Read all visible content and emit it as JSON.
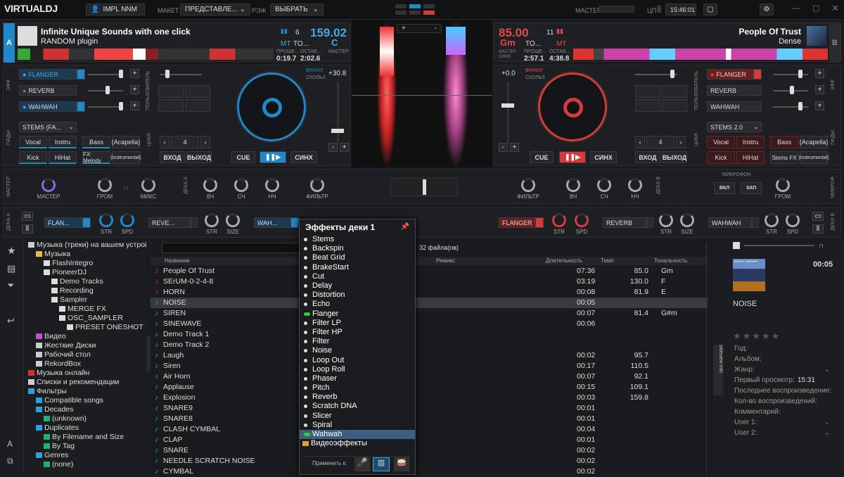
{
  "app": {
    "logo": "VIRTUALDJ",
    "user": "IMPL NNM",
    "layout_label": "МАКЕТ",
    "layout_value": "ПРЕДСТАВЛЕ...",
    "mode_label": "РЭЖ",
    "mode_value": "ВЫБРАТЬ",
    "master_label": "МАСТЕР",
    "cpu_label": "ЦП",
    "clock": "15:46:01"
  },
  "deck_a": {
    "side": "A",
    "title": "Infinite Unique Sounds with one click",
    "artist": "RANDOM plugin",
    "bpm": "159.02",
    "key": "C",
    "key_label": "TO...",
    "pitch_small": "6",
    "elapsed_label": "ПРОШЕ...",
    "elapsed": "0:19.7",
    "remain_label": "ОСТАВ...",
    "remain": "2:02.6",
    "master_label": "МАСТЕР",
    "master_val": "MT",
    "color": "#1e88c8"
  },
  "deck_b": {
    "side": "B",
    "title": "People Of Trust",
    "artist": "Dense",
    "bpm": "85.00",
    "key": "Gm",
    "key_label": "TO...",
    "pitch_small": "11",
    "elapsed_label": "ПРОШЕ...",
    "elapsed": "2:57.1",
    "remain_label": "ОСТАВ...",
    "remain": "4:38.8",
    "sync_label": "СИНХ",
    "master_label": "МАСТЕР",
    "master_val": "MT",
    "color": "#d73a3a"
  },
  "fx_a": {
    "label": "ЭФФ",
    "items": [
      "FLANGER",
      "REVERB",
      "WAHWAH"
    ]
  },
  "fx_b": {
    "label": "ЭФФ",
    "items": [
      "FLANGER",
      "REVERB",
      "WAHWAH"
    ]
  },
  "user_label": "ПОЛЬЗОВАТЕЛЬ",
  "pads_a": {
    "label": "ПАДЫ",
    "stems": "STEMS (FA...",
    "row1": [
      "Vocal",
      "Instru",
      "Bass",
      "(Acapella)"
    ],
    "row2": [
      "Kick",
      "HiHat",
      "FX: Melody",
      "(Instrumental)"
    ],
    "loop_label": "ЦИКЛ",
    "loop": "4",
    "in": "ВХОД",
    "out": "ВЫХОД"
  },
  "pads_b": {
    "label": "ПАДЫ",
    "stems": "STEMS 2.0",
    "row1": [
      "Vocal",
      "Instru",
      "Bass",
      "(Acapella)"
    ],
    "row2": [
      "Kick",
      "HiHat",
      "Stems FX",
      "(Instrumental)"
    ],
    "loop_label": "ЦИКЛ",
    "loop": "4",
    "in": "ВХОД",
    "out": "ВЫХОД"
  },
  "transport_a": {
    "cue": "CUE",
    "sync": "СИНХ",
    "pitch": "+30.8",
    "vinyl1": "ВИНИЛ",
    "vinyl2": "СКОЛЬЗ"
  },
  "transport_b": {
    "cue": "CUE",
    "sync": "СИНХ",
    "pitch": "+0.0",
    "vinyl1": "ВИНИЛ",
    "vinyl2": "СКОЛЬЗ"
  },
  "mixer": {
    "master_side": "МАСТЕР",
    "master": "МАСТЕР",
    "vol": "ГРОМ",
    "mix": "МИКС",
    "hi": "ВЧ",
    "mid": "СЧ",
    "low": "НЧ",
    "filter": "ФИЛЬТР",
    "deck_a": "ДЕКА А",
    "deck_b": "ДЕКА В",
    "mic": "МИКРОФОН",
    "mic_on": "ВКЛ",
    "rec": "ЗАП",
    "mic_vol": "ГРОМ",
    "mic_side": "МИКРОФ"
  },
  "deckfx_a": {
    "side": "ДЕКА А",
    "fx1": "FLAN...",
    "fx2": "REVE...",
    "fx3": "WAH...",
    "str": "STR",
    "spd": "SPD",
    "size": "SIZE"
  },
  "deckfx_b": {
    "side": "ДЕКА В",
    "fx1": "FLANGER",
    "fx2": "REVERB",
    "fx3": "WAHWAH",
    "str": "STR",
    "spd": "SPD",
    "size": "SIZE"
  },
  "tree": [
    {
      "t": "Музыка (треки) на вашем устройстве",
      "i": 0,
      "c": "#ccc"
    },
    {
      "t": "Музыка",
      "i": 1,
      "c": "#e8b84a"
    },
    {
      "t": "FlashIntegro",
      "i": 2,
      "c": "#ddd"
    },
    {
      "t": "PioneerDJ",
      "i": 2,
      "c": "#ddd"
    },
    {
      "t": "Demo Tracks",
      "i": 3,
      "c": "#ddd"
    },
    {
      "t": "Recording",
      "i": 3,
      "c": "#ddd"
    },
    {
      "t": "Sampler",
      "i": 3,
      "c": "#ddd"
    },
    {
      "t": "MERGE FX",
      "i": 4,
      "c": "#ddd"
    },
    {
      "t": "OSC_SAMPLER",
      "i": 4,
      "c": "#ddd"
    },
    {
      "t": "PRESET ONESHOT",
      "i": 5,
      "c": "#ddd"
    },
    {
      "t": "Видео",
      "i": 1,
      "c": "#c44fd0"
    },
    {
      "t": "Жесткие Диски",
      "i": 1,
      "c": "#ccc"
    },
    {
      "t": "Рабочий стол",
      "i": 1,
      "c": "#ccc"
    },
    {
      "t": "RekordBox",
      "i": 1,
      "c": "#ccc"
    },
    {
      "t": "Музыка онлайн",
      "i": 0,
      "c": "#d03030"
    },
    {
      "t": "Списки и рекомендации",
      "i": 0,
      "c": "#ccc"
    },
    {
      "t": "Фильтры",
      "i": 0,
      "c": "#2aa0e0"
    },
    {
      "t": "Compatible songs",
      "i": 1,
      "c": "#2aa0e0"
    },
    {
      "t": "Decades",
      "i": 1,
      "c": "#2aa0e0"
    },
    {
      "t": "(unknown)",
      "i": 2,
      "c": "#20b070"
    },
    {
      "t": "Duplicates",
      "i": 1,
      "c": "#2aa0e0"
    },
    {
      "t": "By Filename and Size",
      "i": 2,
      "c": "#20b070"
    },
    {
      "t": "By Tag",
      "i": 2,
      "c": "#20b070"
    },
    {
      "t": "Genres",
      "i": 1,
      "c": "#2aa0e0"
    },
    {
      "t": "(none)",
      "i": 2,
      "c": "#20b070"
    }
  ],
  "browser": {
    "count": "32 файла(ов)",
    "cols": [
      "Название",
      "Ремикс",
      "Длительность",
      "Темп",
      "Тональность"
    ],
    "folders_tab": "folders",
    "sideview_tab": "sideview info"
  },
  "tracks": [
    {
      "n": "People Of Trust",
      "d": "07:36",
      "b": "85.0",
      "k": "Gm"
    },
    {
      "n": "SErUM-0-2-4-8",
      "d": "03:19",
      "b": "130.0",
      "k": "F"
    },
    {
      "n": "HORN",
      "d": "00:08",
      "b": "81.9",
      "k": "E"
    },
    {
      "n": "NOISE",
      "d": "00:05",
      "b": "",
      "k": ""
    },
    {
      "n": "SIREN",
      "d": "00:07",
      "b": "81.4",
      "k": "G#m"
    },
    {
      "n": "SINEWAVE",
      "d": "00:06",
      "b": "",
      "k": ""
    },
    {
      "n": "Demo Track 1",
      "d": "",
      "b": "",
      "k": ""
    },
    {
      "n": "Demo Track 2",
      "d": "",
      "b": "",
      "k": ""
    },
    {
      "n": "Laugh",
      "d": "00:02",
      "b": "95.7",
      "k": ""
    },
    {
      "n": "Siren",
      "d": "00:17",
      "b": "110.5",
      "k": ""
    },
    {
      "n": "Air Horn",
      "d": "00:07",
      "b": "92.1",
      "k": ""
    },
    {
      "n": "Applause",
      "d": "00:15",
      "b": "109.1",
      "k": ""
    },
    {
      "n": "Explosion",
      "d": "00:03",
      "b": "159.8",
      "k": ""
    },
    {
      "n": "SNARE9",
      "d": "00:01",
      "b": "",
      "k": ""
    },
    {
      "n": "SNARE8",
      "d": "00:01",
      "b": "",
      "k": ""
    },
    {
      "n": "CLASH CYMBAL",
      "d": "00:04",
      "b": "",
      "k": ""
    },
    {
      "n": "CLAP",
      "d": "00:01",
      "b": "",
      "k": ""
    },
    {
      "n": "SNARE",
      "d": "00:02",
      "b": "",
      "k": ""
    },
    {
      "n": "NEEDLE SCRATCH NOISE",
      "d": "00:02",
      "b": "",
      "k": ""
    },
    {
      "n": "CYMBAL",
      "d": "00:02",
      "b": "",
      "k": ""
    }
  ],
  "fxmenu": {
    "title": "Эффекты деки 1",
    "items": [
      "Stems",
      "Backspin",
      "Beat Grid",
      "BrakeStart",
      "Cut",
      "Delay",
      "Distortion",
      "Echo",
      "Flanger",
      "Filter LP",
      "Filter HP",
      "Filter",
      "Noise",
      "Loop Out",
      "Loop Roll",
      "Phaser",
      "Pitch",
      "Reverb",
      "Scratch DNA",
      "Slicer",
      "Spiral",
      "Wahwah"
    ],
    "video": "Видеоэффекты",
    "apply": "Применить к:"
  },
  "info": {
    "art_text": "KENNY CHESNEY",
    "time": "00:05",
    "title": "NOISE",
    "fields": [
      "Год:",
      "Альбом:",
      "Жанр:",
      "Первый просмотр:",
      "Последнее воспроизведение:",
      "Кол-во воспроизведений:",
      "Комментарий:",
      "User 1:",
      "User 2:"
    ],
    "first_seen": "15:31"
  },
  "colors": {
    "deck_a": "#1e88c8",
    "deck_b": "#d73a3a",
    "bg": "#1a1b1e"
  }
}
